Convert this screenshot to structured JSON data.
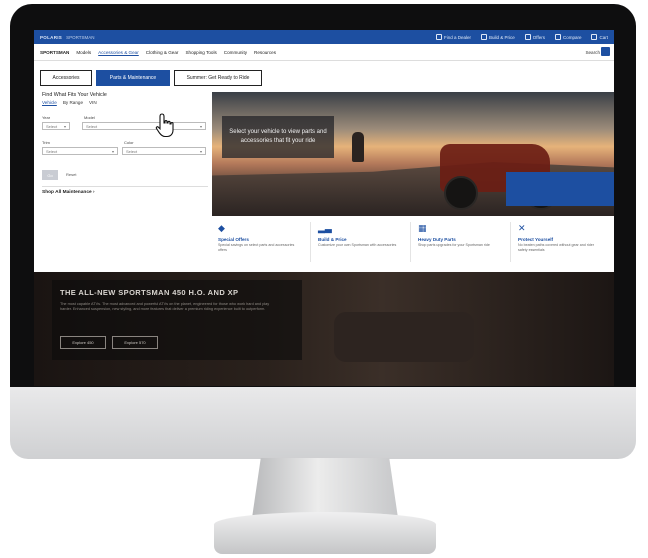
{
  "topbar": {
    "brand": "POLARIS",
    "sub": "SPORTSMAN",
    "links": [
      "Find a Dealer",
      "Build & Price",
      "Offers",
      "Compare",
      "Cart"
    ]
  },
  "nav": {
    "logo": "SPORTSMAN",
    "items": [
      "Models",
      "Accessories & Gear",
      "Clothing & Gear",
      "Shopping Tools",
      "Community",
      "Resources"
    ],
    "active_index": 1,
    "search_label": "Search"
  },
  "tabs": {
    "accessories": "Accessories",
    "parts": "Parts & Maintenance",
    "summer": "Summer: Get Ready to Ride"
  },
  "finder": {
    "title": "Find What Fits Your Vehicle",
    "modes": [
      "Vehicle",
      "By Range",
      "VIN"
    ],
    "year_label": "Year",
    "year_value": "Select",
    "model_label": "Model",
    "model_value": "Select",
    "trim_label": "Trim",
    "trim_value": "Select",
    "color_label": "Color",
    "color_value": "Select",
    "go_label": "Go",
    "reset_label": "Reset",
    "shop_all": "Shop All Maintenance"
  },
  "hero": {
    "caption": "Select your vehicle to view parts and accessories that fit your ride"
  },
  "tiles": [
    {
      "icon": "tag-icon",
      "glyph": "◆",
      "title": "Special Offers",
      "desc": "Special savings on select parts and accessories offers"
    },
    {
      "icon": "atv-icon",
      "glyph": "▂▃",
      "title": "Build & Price",
      "desc": "Customize your own Sportsman with accessories"
    },
    {
      "icon": "parts-icon",
      "glyph": "▦",
      "title": "Heavy Duty Parts",
      "desc": "Shop parts upgrades for your Sportsman ride"
    },
    {
      "icon": "wrench-icon",
      "glyph": "✕",
      "title": "Protect Yourself",
      "desc": "No beaten paths covered without gear and rider safety essentials"
    }
  ],
  "promo": {
    "title": "THE ALL-NEW SPORTSMAN 450 H.O. AND XP",
    "text": "The most capable ATVs. The most advanced and powerful ATVs on the planet, engineered for those who work hard and play harder. Enhanced suspension, new styling, and more features that deliver a premium riding experience built to outperform.",
    "btn1": "Explore 450",
    "btn2": "Explore 570"
  },
  "colors": {
    "brand": "#1d4fa1"
  }
}
